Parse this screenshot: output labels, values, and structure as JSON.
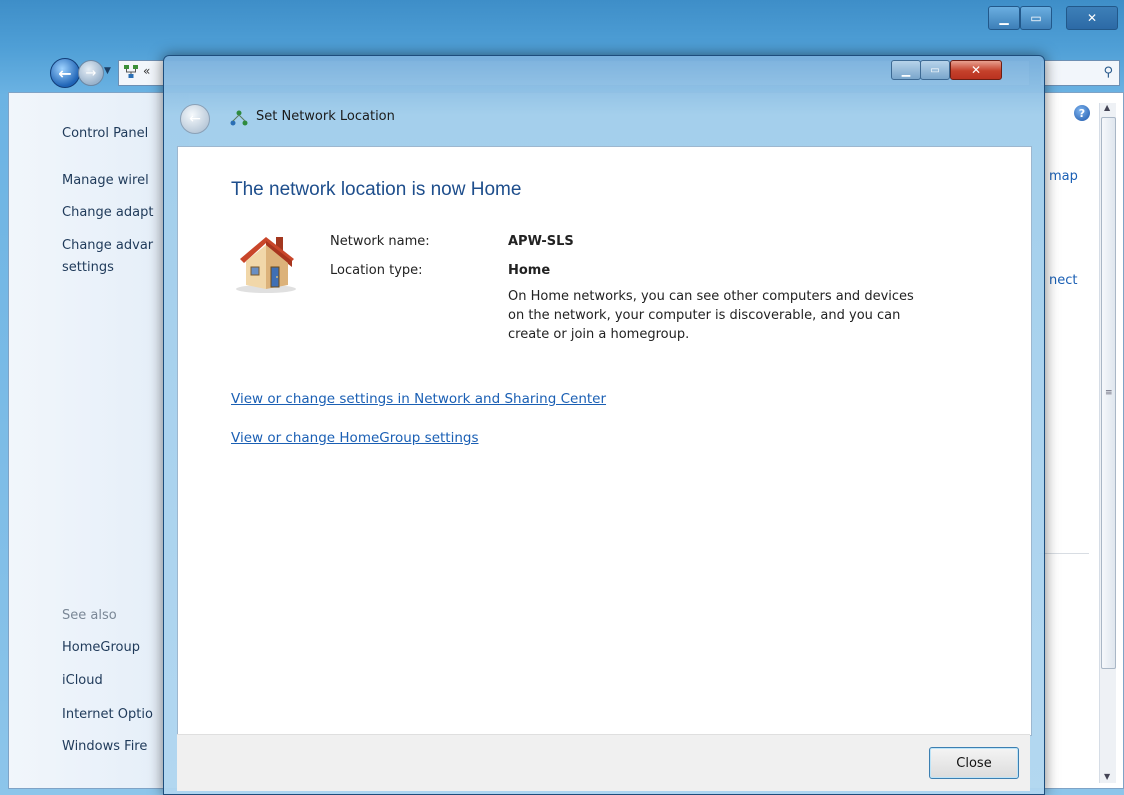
{
  "background_window": {
    "address_crumb": "«",
    "left_pane": {
      "crumb": "Control Panel",
      "links": [
        "Manage wirel",
        "Change adapt",
        "Change advar",
        "settings"
      ],
      "see_also_label": "See also",
      "see_also": [
        "HomeGroup",
        "iCloud",
        "Internet Optio",
        "Windows Fire"
      ]
    },
    "right_links": [
      "map",
      "nect"
    ]
  },
  "dialog": {
    "title": "Set Network Location",
    "heading": "The network location is now Home",
    "network_name_label": "Network name:",
    "network_name_value": "APW-SLS",
    "location_type_label": "Location type:",
    "location_type_value": "Home",
    "location_description": "On Home networks, you can see other computers and devices on the network, your computer is discoverable, and you can create or join a homegroup.",
    "links": [
      "View or change settings in Network and Sharing Center",
      "View or change HomeGroup settings"
    ],
    "close_button": "Close"
  },
  "icons": {
    "nav": [
      "back-arrow-icon",
      "forward-arrow-icon",
      "network-icon",
      "search-icon",
      "help-icon"
    ],
    "dialog": [
      "back-arrow-icon",
      "network-icon",
      "home-icon"
    ]
  },
  "colors": {
    "link": "#1a5fb4",
    "heading": "#1e4e8c",
    "close_red": "#c5412b"
  }
}
